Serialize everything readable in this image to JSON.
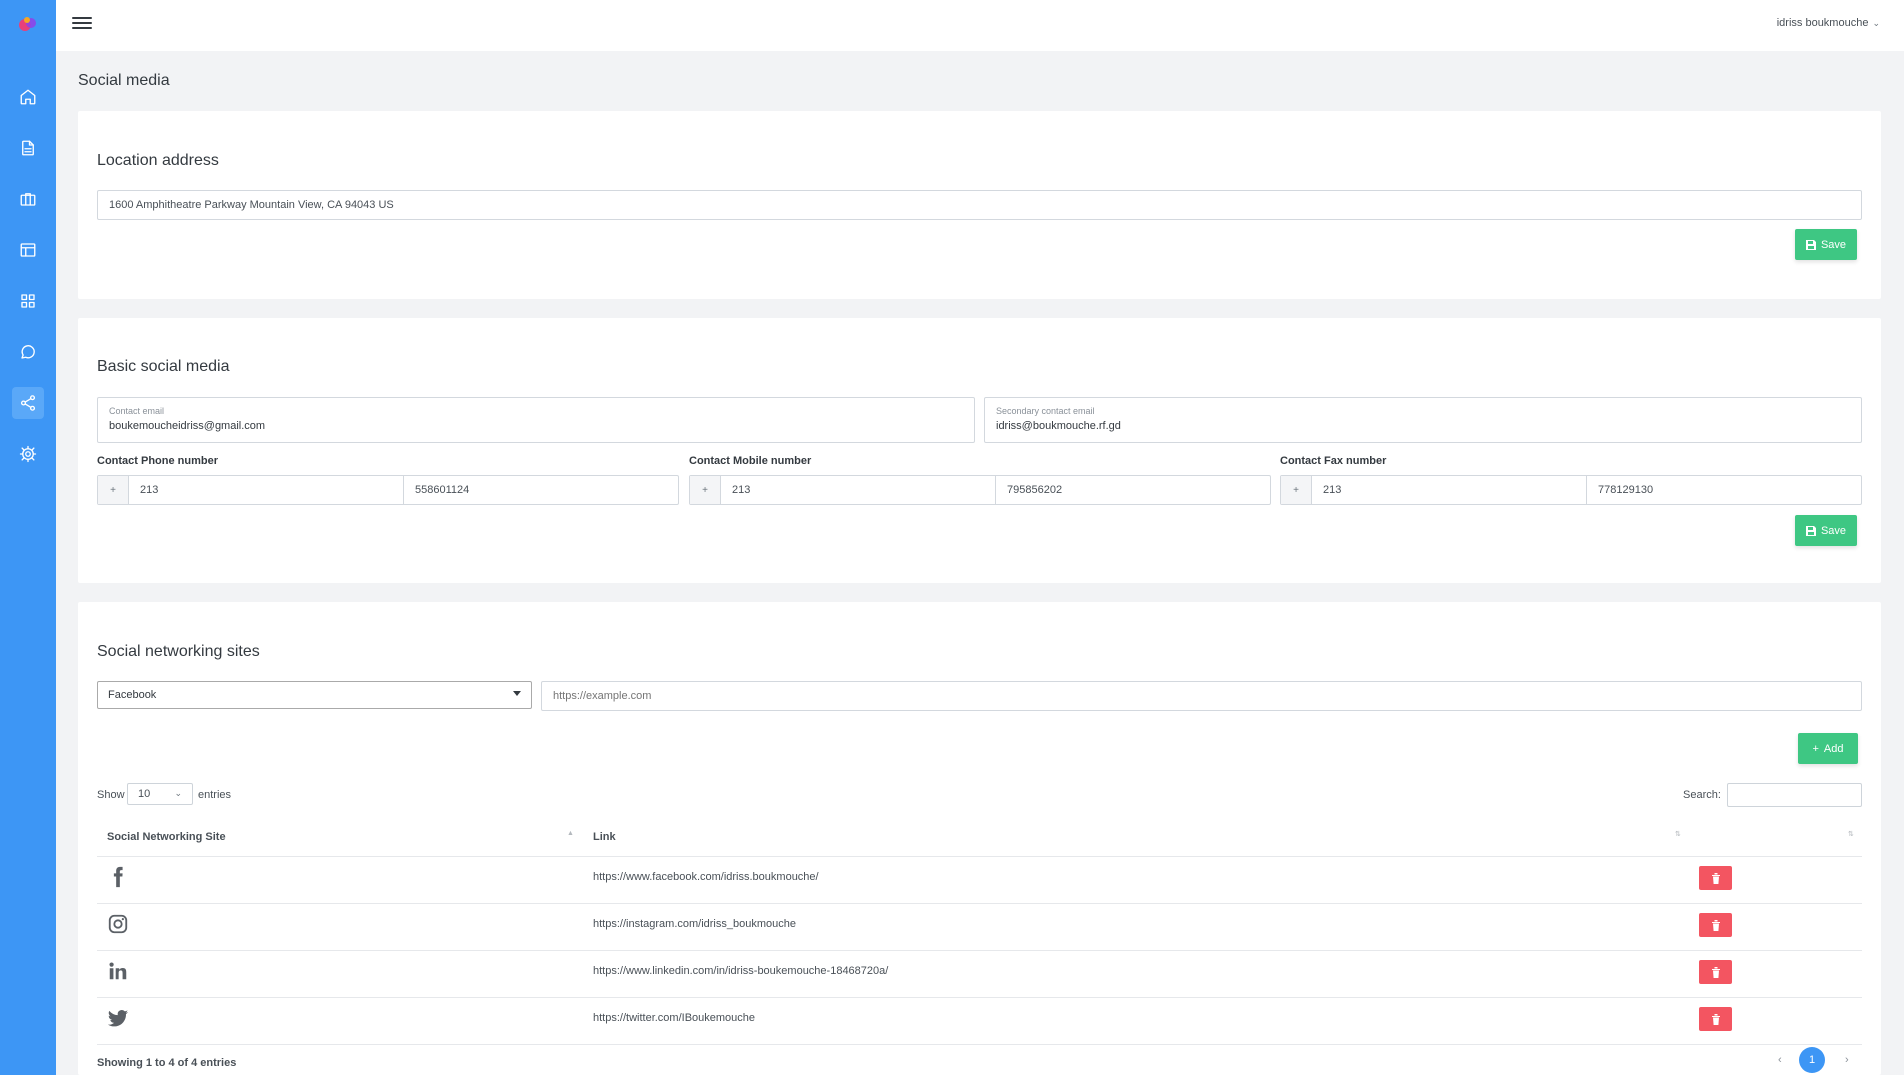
{
  "header": {
    "user_name": "idriss boukmouche"
  },
  "page": {
    "title": "Social media"
  },
  "location": {
    "title": "Location address",
    "address_value": "1600 Amphitheatre Parkway Mountain View, CA 94043 US",
    "save_label": "Save"
  },
  "basic": {
    "title": "Basic social media",
    "contact_email_label": "Contact email",
    "contact_email_value": "boukemoucheidriss@gmail.com",
    "secondary_email_label": "Secondary contact email",
    "secondary_email_value": "idriss@boukmouche.rf.gd",
    "phone_label": "Contact Phone number",
    "mobile_label": "Contact Mobile number",
    "fax_label": "Contact Fax number",
    "plus": "+",
    "phone": {
      "code": "213",
      "number": "558601124"
    },
    "mobile": {
      "code": "213",
      "number": "795856202"
    },
    "fax": {
      "code": "213",
      "number": "778129130"
    },
    "save_label": "Save"
  },
  "sites": {
    "title": "Social networking sites",
    "select_value": "Facebook",
    "url_placeholder": "https://example.com",
    "add_label": "Add",
    "show_label": "Show",
    "length_value": "10",
    "entries_label": "entries",
    "search_label": "Search:",
    "col_site": "Social Networking Site",
    "col_link": "Link",
    "rows": [
      {
        "icon": "facebook-icon",
        "link": "https://www.facebook.com/idriss.boukmouche/"
      },
      {
        "icon": "instagram-icon",
        "link": "https://instagram.com/idriss_boukmouche"
      },
      {
        "icon": "linkedin-icon",
        "link": "https://www.linkedin.com/in/idriss-boukemouche-18468720a/"
      },
      {
        "icon": "twitter-icon",
        "link": "https://twitter.com/IBoukemouche"
      }
    ],
    "info": "Showing 1 to 4 of 4 entries",
    "current_page": "1",
    "prev": "‹",
    "next": "›"
  },
  "colors": {
    "sidebar": "#3d96f5",
    "save": "#3ec783",
    "delete": "#f35561"
  }
}
